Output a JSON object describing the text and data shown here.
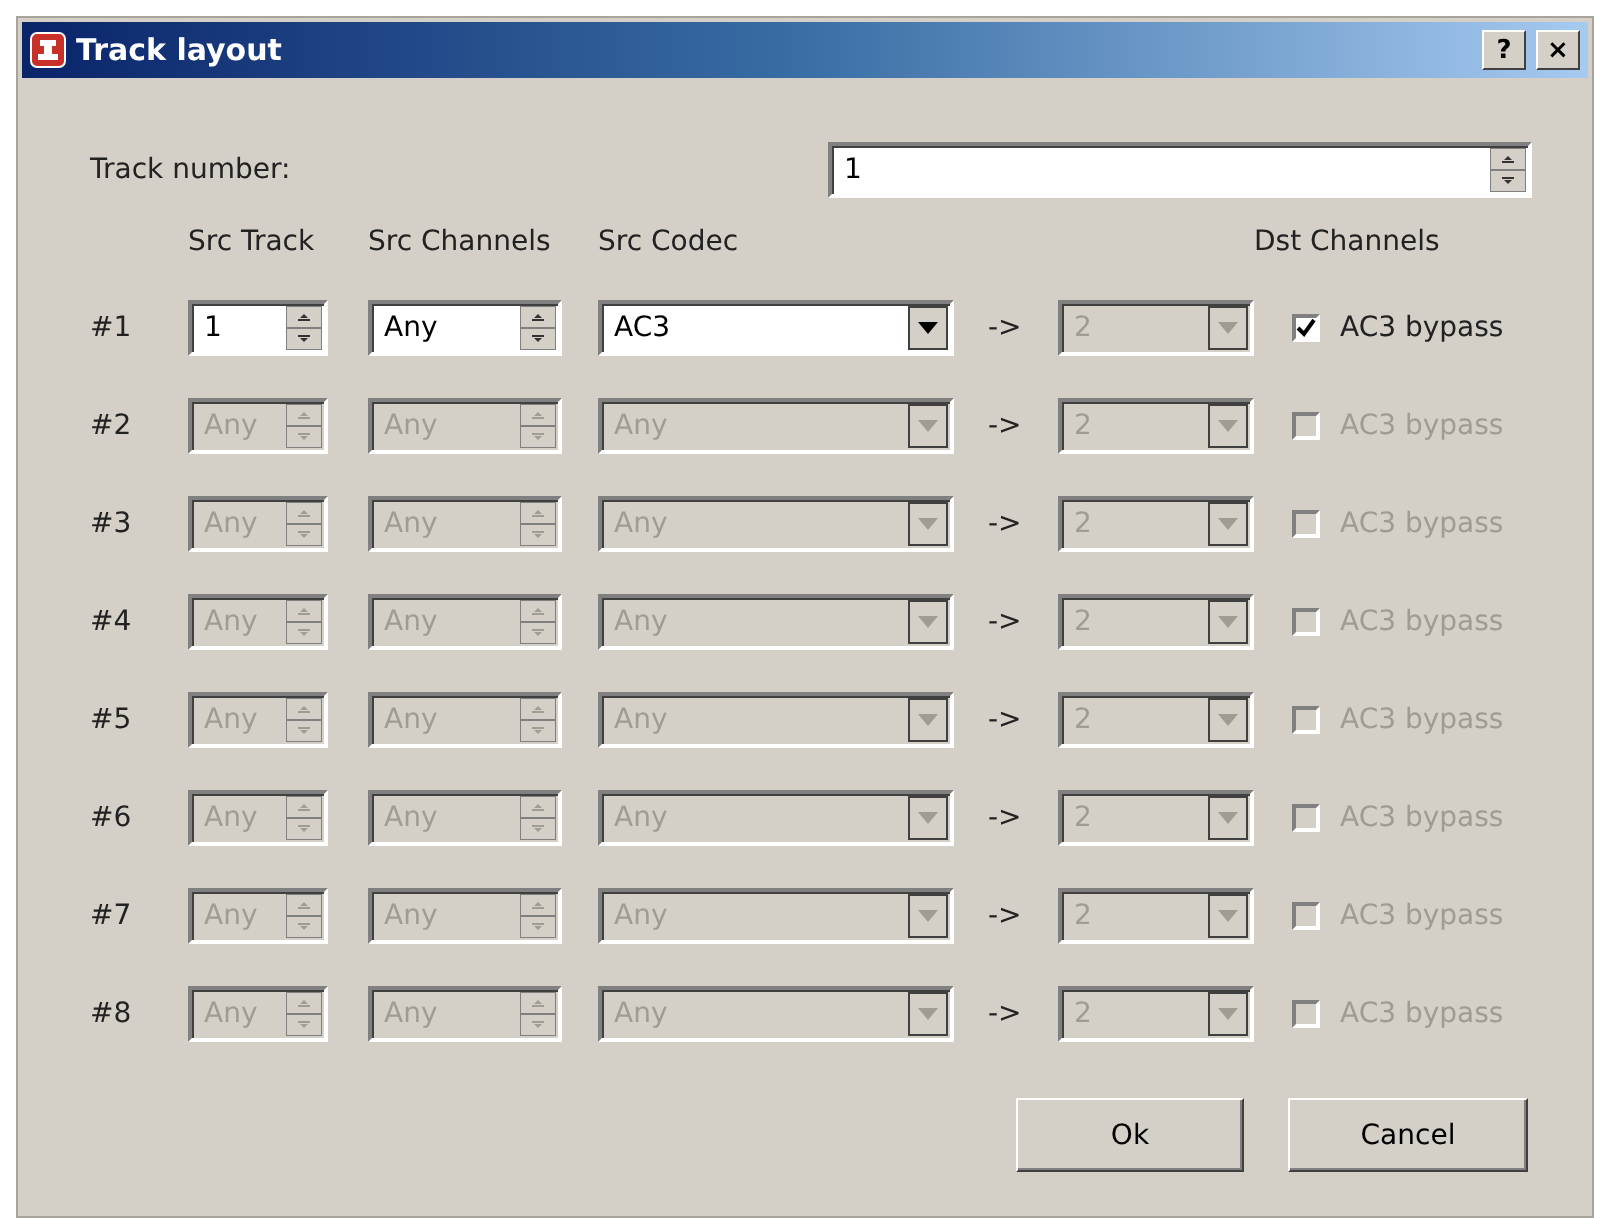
{
  "window": {
    "title": "Track layout",
    "help_button": "?",
    "close_button": "×"
  },
  "track_number": {
    "label": "Track number:",
    "value": "1"
  },
  "columns": [
    "Src Track",
    "Src Channels",
    "Src Codec",
    "Dst Channels"
  ],
  "rows": [
    {
      "label": "#1",
      "src_track": "1",
      "src_channels": "Any",
      "src_codec": "AC3",
      "arrow": "->",
      "dst_channels": "2",
      "bypass": {
        "label": "AC3 bypass",
        "checked": true
      },
      "disabled": false,
      "dst_disabled": true
    },
    {
      "label": "#2",
      "src_track": "Any",
      "src_channels": "Any",
      "src_codec": "Any",
      "arrow": "->",
      "dst_channels": "2",
      "bypass": {
        "label": "AC3 bypass",
        "checked": false
      },
      "disabled": true,
      "dst_disabled": true
    },
    {
      "label": "#3",
      "src_track": "Any",
      "src_channels": "Any",
      "src_codec": "Any",
      "arrow": "->",
      "dst_channels": "2",
      "bypass": {
        "label": "AC3 bypass",
        "checked": false
      },
      "disabled": true,
      "dst_disabled": true
    },
    {
      "label": "#4",
      "src_track": "Any",
      "src_channels": "Any",
      "src_codec": "Any",
      "arrow": "->",
      "dst_channels": "2",
      "bypass": {
        "label": "AC3 bypass",
        "checked": false
      },
      "disabled": true,
      "dst_disabled": true
    },
    {
      "label": "#5",
      "src_track": "Any",
      "src_channels": "Any",
      "src_codec": "Any",
      "arrow": "->",
      "dst_channels": "2",
      "bypass": {
        "label": "AC3 bypass",
        "checked": false
      },
      "disabled": true,
      "dst_disabled": true
    },
    {
      "label": "#6",
      "src_track": "Any",
      "src_channels": "Any",
      "src_codec": "Any",
      "arrow": "->",
      "dst_channels": "2",
      "bypass": {
        "label": "AC3 bypass",
        "checked": false
      },
      "disabled": true,
      "dst_disabled": true
    },
    {
      "label": "#7",
      "src_track": "Any",
      "src_channels": "Any",
      "src_codec": "Any",
      "arrow": "->",
      "dst_channels": "2",
      "bypass": {
        "label": "AC3 bypass",
        "checked": false
      },
      "disabled": true,
      "dst_disabled": true
    },
    {
      "label": "#8",
      "src_track": "Any",
      "src_channels": "Any",
      "src_codec": "Any",
      "arrow": "->",
      "dst_channels": "2",
      "bypass": {
        "label": "AC3 bypass",
        "checked": false
      },
      "disabled": true,
      "dst_disabled": true
    }
  ],
  "buttons": [
    "Ok",
    "Cancel"
  ]
}
